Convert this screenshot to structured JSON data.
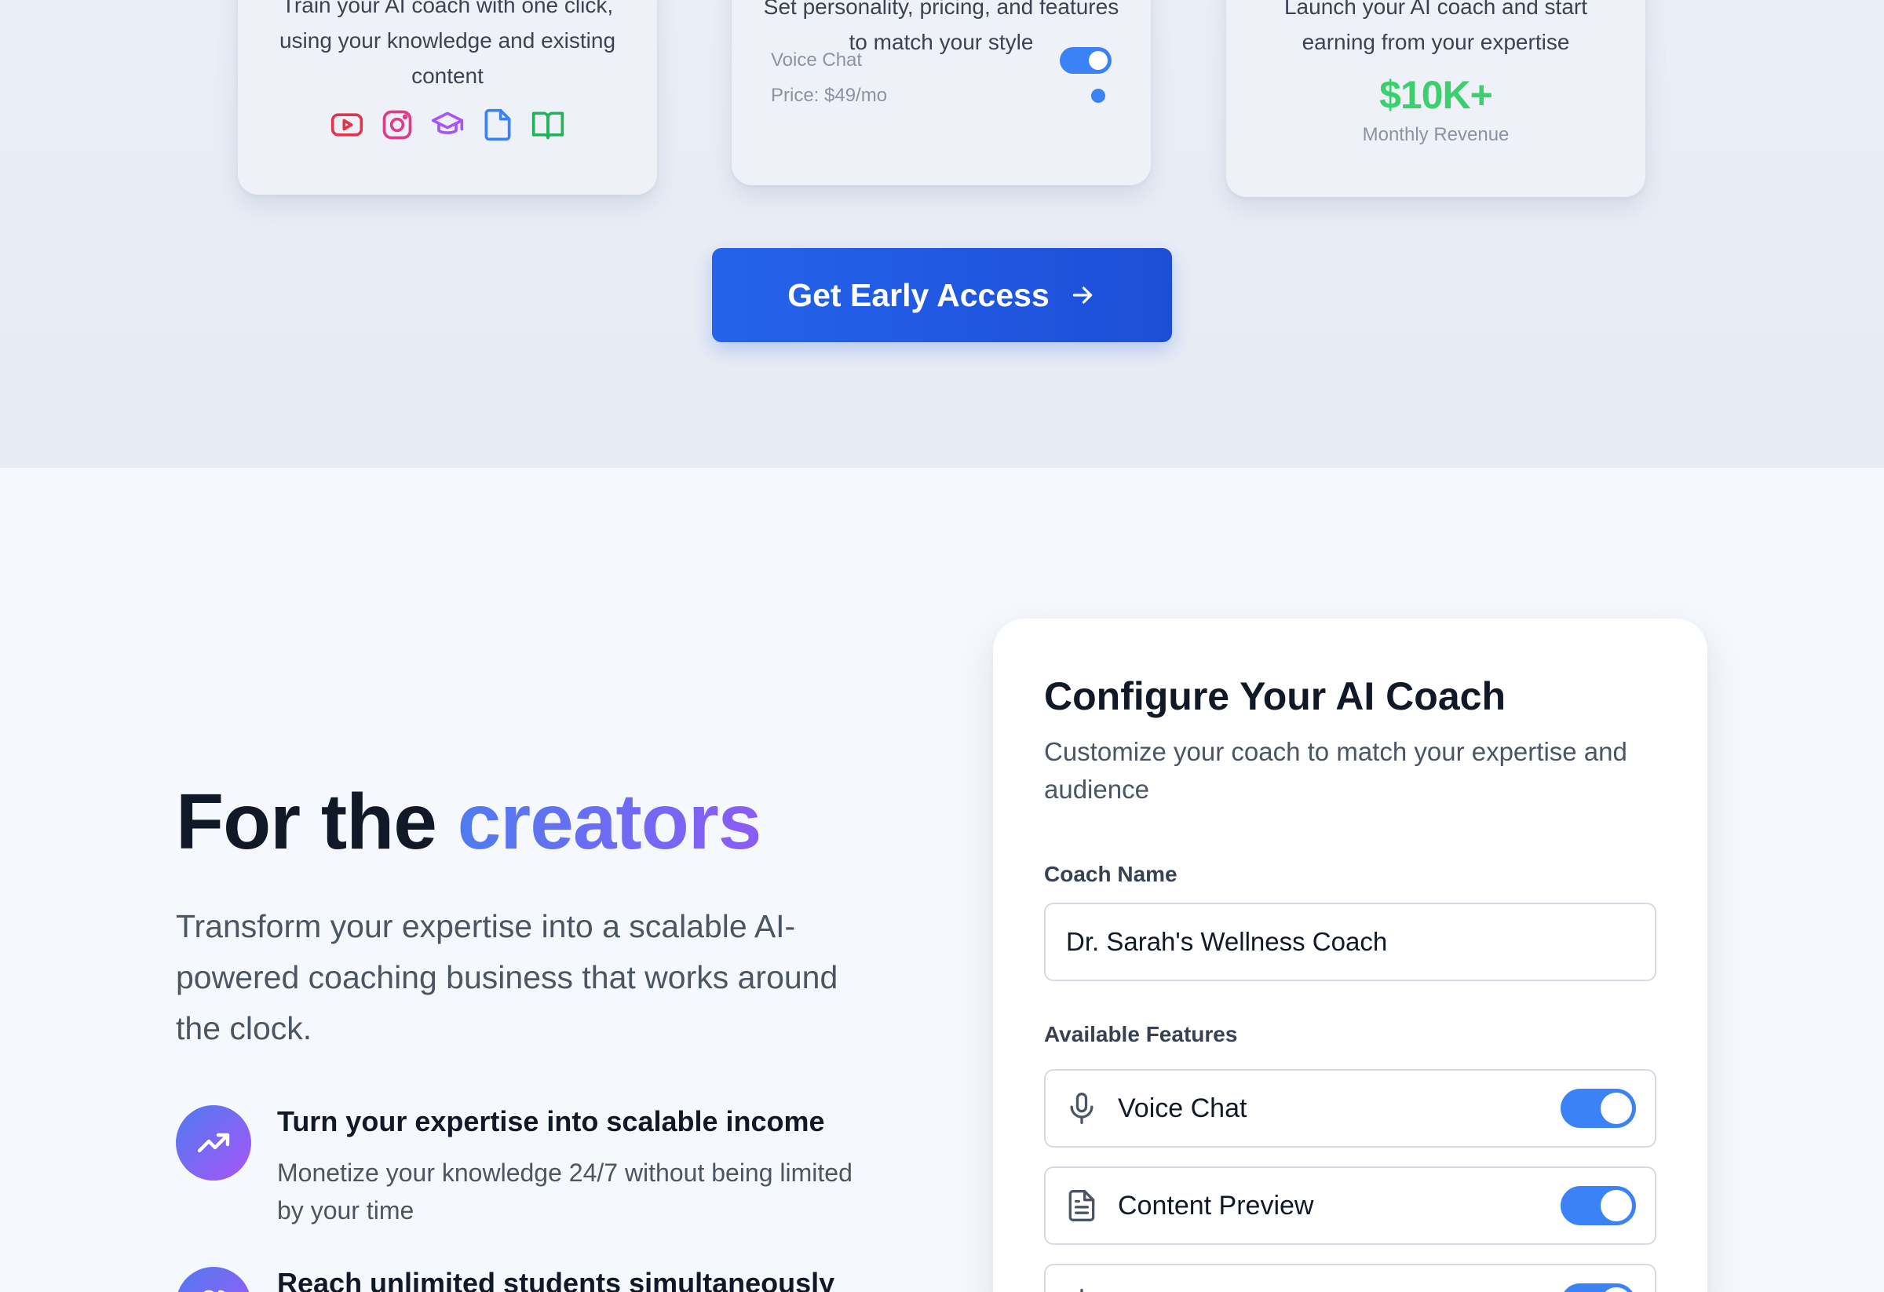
{
  "steps": {
    "train": {
      "description": "Train your AI coach with one click, using your knowledge and existing content",
      "source_icons": [
        "youtube-icon",
        "instagram-icon",
        "graduation-cap-icon",
        "document-icon",
        "book-icon"
      ]
    },
    "customize": {
      "description": "Set personality, pricing, and features to match your style",
      "voice_chat_label": "Voice Chat",
      "price_label": "Price: $49/mo"
    },
    "launch": {
      "description": "Launch your AI coach and start earning from your expertise",
      "revenue_value": "$10K+",
      "revenue_label": "Monthly Revenue"
    }
  },
  "cta": {
    "label": "Get Early Access"
  },
  "creators": {
    "title_prefix": "For the",
    "title_accent": "creators",
    "subtitle": "Transform your expertise into a scalable AI-powered coaching business that works around the clock.",
    "benefits": [
      {
        "title": "Turn your expertise into scalable income",
        "description": "Monetize your knowledge 24/7 without being limited by your time"
      },
      {
        "title": "Reach unlimited students simultaneously",
        "description": ""
      }
    ]
  },
  "config": {
    "title": "Configure Your AI Coach",
    "subtitle": "Customize your coach to match your expertise and audience",
    "coach_name_label": "Coach Name",
    "coach_name_value": "Dr. Sarah's Wellness Coach",
    "features_label": "Available Features",
    "features": [
      {
        "label": "Voice Chat",
        "enabled": true,
        "icon": "microphone-icon"
      },
      {
        "label": "Content Preview",
        "enabled": true,
        "icon": "document-icon"
      },
      {
        "label": "",
        "enabled": true,
        "icon": "feature-icon"
      }
    ]
  },
  "colors": {
    "accent_blue": "#2563eb",
    "toggle_on": "#3b82f6",
    "revenue_green": "#3ccf6e",
    "gradient_start": "#4f7bf0",
    "gradient_end": "#8b5cf6"
  }
}
